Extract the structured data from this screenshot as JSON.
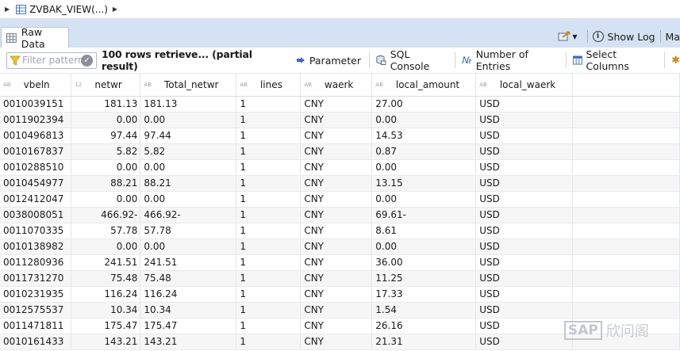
{
  "breadcrumb": {
    "label": "ZVBAK_VIEW(...)"
  },
  "tabs": [
    {
      "label": "Raw Data",
      "active": true
    }
  ],
  "right_tools": {
    "show_log": "Show Log",
    "more": "Ma"
  },
  "toolbar": {
    "filter_placeholder": "Filter pattern",
    "status": "100 rows retrieve... (partial result)",
    "parameter": "Parameter",
    "sql_console": "SQL Console",
    "number_of_entries": "Number of Entries",
    "select_columns": "Select Columns"
  },
  "table": {
    "columns": [
      {
        "name": "vbeln",
        "type": "AB"
      },
      {
        "name": "netwr",
        "type": "12"
      },
      {
        "name": "Total_netwr",
        "type": "AB"
      },
      {
        "name": "lines",
        "type": "AB"
      },
      {
        "name": "waerk",
        "type": "AB"
      },
      {
        "name": "local_amount",
        "type": "AB"
      },
      {
        "name": "local_waerk",
        "type": "AB"
      }
    ],
    "rows": [
      [
        "0010039151",
        "181.13",
        "181.13",
        "1",
        "CNY",
        "27.00",
        "USD"
      ],
      [
        "0011902394",
        "0.00",
        "0.00",
        "1",
        "CNY",
        "0.00",
        "USD"
      ],
      [
        "0010496813",
        "97.44",
        "97.44",
        "1",
        "CNY",
        "14.53",
        "USD"
      ],
      [
        "0010167837",
        "5.82",
        "5.82",
        "1",
        "CNY",
        "0.87",
        "USD"
      ],
      [
        "0010288510",
        "0.00",
        "0.00",
        "1",
        "CNY",
        "0.00",
        "USD"
      ],
      [
        "0010454977",
        "88.21",
        "88.21",
        "1",
        "CNY",
        "13.15",
        "USD"
      ],
      [
        "0012412047",
        "0.00",
        "0.00",
        "1",
        "CNY",
        "0.00",
        "USD"
      ],
      [
        "0038008051",
        "466.92-",
        "466.92-",
        "1",
        "CNY",
        "69.61-",
        "USD"
      ],
      [
        "0011070335",
        "57.78",
        "57.78",
        "1",
        "CNY",
        "8.61",
        "USD"
      ],
      [
        "0010138982",
        "0.00",
        "0.00",
        "1",
        "CNY",
        "0.00",
        "USD"
      ],
      [
        "0011280936",
        "241.51",
        "241.51",
        "1",
        "CNY",
        "36.00",
        "USD"
      ],
      [
        "0011731270",
        "75.48",
        "75.48",
        "1",
        "CNY",
        "11.25",
        "USD"
      ],
      [
        "0010231935",
        "116.24",
        "116.24",
        "1",
        "CNY",
        "17.33",
        "USD"
      ],
      [
        "0012575537",
        "10.34",
        "10.34",
        "1",
        "CNY",
        "1.54",
        "USD"
      ],
      [
        "0011471811",
        "175.47",
        "175.47",
        "1",
        "CNY",
        "26.16",
        "USD"
      ],
      [
        "0010161433",
        "143.21",
        "143.21",
        "1",
        "CNY",
        "21.31",
        "USD"
      ]
    ]
  },
  "watermark": {
    "text": "SAP",
    "cn": "欣问阁"
  },
  "colors": {
    "tab_strip_bg": "#d5e2f3",
    "accent_blue": "#2f6fb6"
  }
}
